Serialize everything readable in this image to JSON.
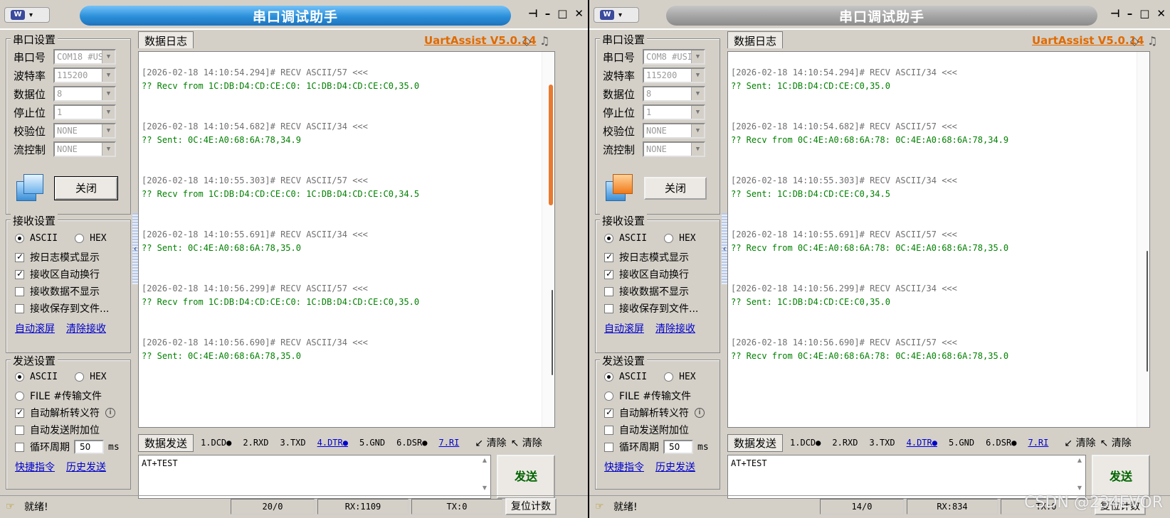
{
  "colors": {
    "accent": "#2b8fd9",
    "link": "#0000cc",
    "recv_text": "#008000",
    "brand": "#e06a00"
  },
  "windows": [
    {
      "title": "串口调试助手",
      "brand": "UartAssist V5.0.14",
      "serial": {
        "group": "串口设置",
        "port_label": "串口号",
        "port": "COM18 #US",
        "baud_label": "波特率",
        "baud": "115200",
        "data_label": "数据位",
        "data": "8",
        "stop_label": "停止位",
        "stop": "1",
        "parity_label": "校验位",
        "parity": "NONE",
        "flow_label": "流控制",
        "flow": "NONE",
        "close_button": "关闭"
      },
      "recv": {
        "group": "接收设置",
        "ascii": "ASCII",
        "hex": "HEX",
        "log_mode": "按日志模式显示",
        "auto_wrap": "接收区自动换行",
        "no_show": "接收数据不显示",
        "save_file": "接收保存到文件...",
        "auto_scroll": "自动滚屏",
        "clear_recv": "清除接收"
      },
      "send": {
        "group": "发送设置",
        "ascii": "ASCII",
        "hex": "HEX",
        "file": "FILE #传输文件",
        "escape": "自动解析转义符",
        "append": "自动发送附加位",
        "cycle": "循环周期",
        "cycle_value": "50",
        "cycle_unit": "ms",
        "shortcut": "快捷指令",
        "history": "历史发送"
      },
      "log_tab": "数据日志",
      "log": [
        {
          "head": "[2026-02-18 14:10:54.294]# RECV ASCII/57 <<<",
          "body": "?? Recv from 1C:DB:D4:CD:CE:C0: 1C:DB:D4:CD:CE:C0,35.0"
        },
        {
          "head": "[2026-02-18 14:10:54.682]# RECV ASCII/34 <<<",
          "body": "?? Sent: 0C:4E:A0:68:6A:78,34.9"
        },
        {
          "head": "[2026-02-18 14:10:55.303]# RECV ASCII/57 <<<",
          "body": "?? Recv from 1C:DB:D4:CD:CE:C0: 1C:DB:D4:CD:CE:C0,34.5"
        },
        {
          "head": "[2026-02-18 14:10:55.691]# RECV ASCII/34 <<<",
          "body": "?? Sent: 0C:4E:A0:68:6A:78,35.0"
        },
        {
          "head": "[2026-02-18 14:10:56.299]# RECV ASCII/57 <<<",
          "body": "?? Recv from 1C:DB:D4:CD:CE:C0: 1C:DB:D4:CD:CE:C0,35.0"
        },
        {
          "head": "[2026-02-18 14:10:56.690]# RECV ASCII/34 <<<",
          "body": "?? Sent: 0C:4E:A0:68:6A:78,35.0"
        }
      ],
      "sendbar": {
        "tab": "数据发送",
        "pins": [
          "1.DCD●",
          "2.RXD",
          "3.TXD",
          "4.DTR●",
          "5.GND",
          "6.DSR●",
          "7.RI"
        ],
        "clear1": "清除",
        "clear2": "清除"
      },
      "send_text": "AT+TEST",
      "send_button": "发送",
      "status": {
        "ready": "就绪!",
        "count": "20/0",
        "rx": "RX:1109",
        "tx": "TX:0",
        "reset": "复位计数"
      }
    },
    {
      "title": "串口调试助手",
      "brand": "UartAssist V5.0.14",
      "serial": {
        "group": "串口设置",
        "port_label": "串口号",
        "port": "COM8 #USI",
        "baud_label": "波特率",
        "baud": "115200",
        "data_label": "数据位",
        "data": "8",
        "stop_label": "停止位",
        "stop": "1",
        "parity_label": "校验位",
        "parity": "NONE",
        "flow_label": "流控制",
        "flow": "NONE",
        "close_button": "关闭"
      },
      "recv": {
        "group": "接收设置",
        "ascii": "ASCII",
        "hex": "HEX",
        "log_mode": "按日志模式显示",
        "auto_wrap": "接收区自动换行",
        "no_show": "接收数据不显示",
        "save_file": "接收保存到文件...",
        "auto_scroll": "自动滚屏",
        "clear_recv": "清除接收"
      },
      "send": {
        "group": "发送设置",
        "ascii": "ASCII",
        "hex": "HEX",
        "file": "FILE #传输文件",
        "escape": "自动解析转义符",
        "append": "自动发送附加位",
        "cycle": "循环周期",
        "cycle_value": "50",
        "cycle_unit": "ms",
        "shortcut": "快捷指令",
        "history": "历史发送"
      },
      "log_tab": "数据日志",
      "log": [
        {
          "head": "[2026-02-18 14:10:54.294]# RECV ASCII/34 <<<",
          "body": "?? Sent: 1C:DB:D4:CD:CE:C0,35.0"
        },
        {
          "head": "[2026-02-18 14:10:54.682]# RECV ASCII/57 <<<",
          "body": "?? Recv from 0C:4E:A0:68:6A:78: 0C:4E:A0:68:6A:78,34.9"
        },
        {
          "head": "[2026-02-18 14:10:55.303]# RECV ASCII/34 <<<",
          "body": "?? Sent: 1C:DB:D4:CD:CE:C0,34.5"
        },
        {
          "head": "[2026-02-18 14:10:55.691]# RECV ASCII/57 <<<",
          "body": "?? Recv from 0C:4E:A0:68:6A:78: 0C:4E:A0:68:6A:78,35.0"
        },
        {
          "head": "[2026-02-18 14:10:56.299]# RECV ASCII/34 <<<",
          "body": "?? Sent: 1C:DB:D4:CD:CE:C0,35.0"
        },
        {
          "head": "[2026-02-18 14:10:56.690]# RECV ASCII/57 <<<",
          "body": "?? Recv from 0C:4E:A0:68:6A:78: 0C:4E:A0:68:6A:78,35.0"
        }
      ],
      "sendbar": {
        "tab": "数据发送",
        "pins": [
          "1.DCD●",
          "2.RXD",
          "3.TXD",
          "4.DTR●",
          "5.GND",
          "6.DSR●",
          "7.RI"
        ],
        "clear1": "清除",
        "clear2": "清除"
      },
      "send_text": "AT+TEST",
      "send_button": "发送",
      "status": {
        "ready": "就绪!",
        "count": "14/0",
        "rx": "RX:834",
        "tx": "TX:0",
        "reset": "复位计数"
      }
    }
  ],
  "watermark": "CSDN @234EVOR"
}
